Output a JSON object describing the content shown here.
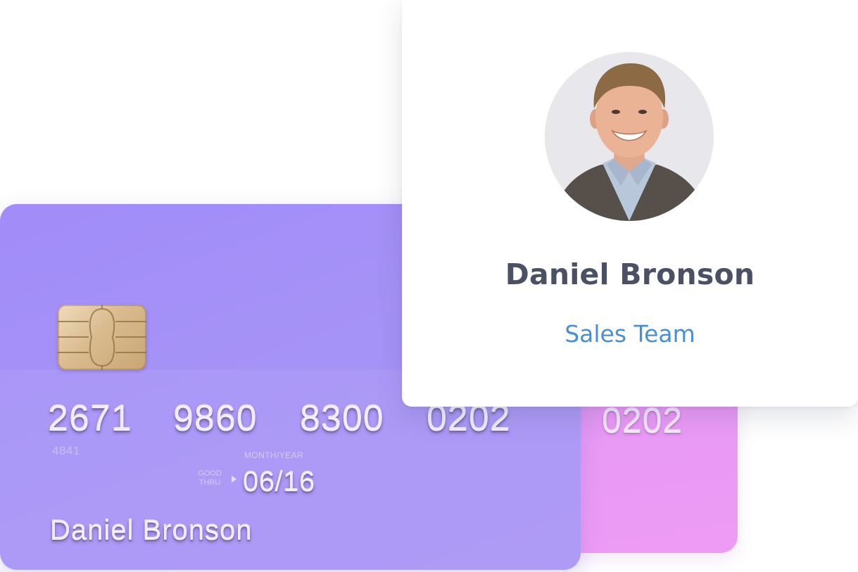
{
  "colors": {
    "front_card": "#a693f7",
    "back_card": "#e69af5",
    "profile_name": "#4a5164",
    "profile_team": "#4a8fd6",
    "background": "#ffffff"
  },
  "back_card": {
    "number_group": "0202"
  },
  "front_card": {
    "chip_icon": "emv-chip-icon",
    "number_groups": [
      "2671",
      "9860",
      "8300",
      "0202"
    ],
    "small_digits": "4841",
    "month_year_label": "MONTH/YEAR",
    "good_label": "GOOD",
    "thru_label": "THRU",
    "expiry": "06/16",
    "holder_name": "Daniel Bronson"
  },
  "profile": {
    "avatar_icon": "profile-photo",
    "name": "Daniel Bronson",
    "team": "Sales Team"
  }
}
